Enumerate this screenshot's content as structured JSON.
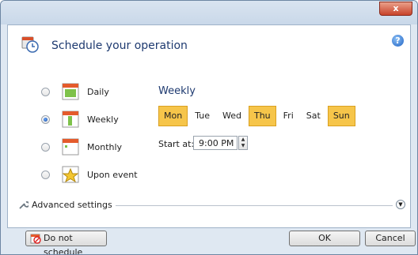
{
  "window": {
    "close_label": "x"
  },
  "header": {
    "title": "Schedule your operation",
    "help_label": "?"
  },
  "schedule_options": [
    {
      "label": "Daily",
      "selected": false,
      "icon": "daily-calendar-icon"
    },
    {
      "label": "Weekly",
      "selected": true,
      "icon": "weekly-calendar-icon"
    },
    {
      "label": "Monthly",
      "selected": false,
      "icon": "monthly-calendar-icon"
    },
    {
      "label": "Upon event",
      "selected": false,
      "icon": "event-star-icon"
    }
  ],
  "weekly": {
    "heading": "Weekly",
    "days": [
      {
        "label": "Mon",
        "selected": true
      },
      {
        "label": "Tue",
        "selected": false
      },
      {
        "label": "Wed",
        "selected": false
      },
      {
        "label": "Thu",
        "selected": true
      },
      {
        "label": "Fri",
        "selected": false
      },
      {
        "label": "Sat",
        "selected": false
      },
      {
        "label": "Sun",
        "selected": true
      }
    ],
    "start_label": "Start at:",
    "start_time": "9:00 PM"
  },
  "advanced": {
    "label": "Advanced settings"
  },
  "footer": {
    "do_not_schedule": "Do not schedule",
    "ok": "OK",
    "cancel": "Cancel"
  },
  "colors": {
    "selected_day": "#f6c54a",
    "heading": "#1e3a70"
  }
}
